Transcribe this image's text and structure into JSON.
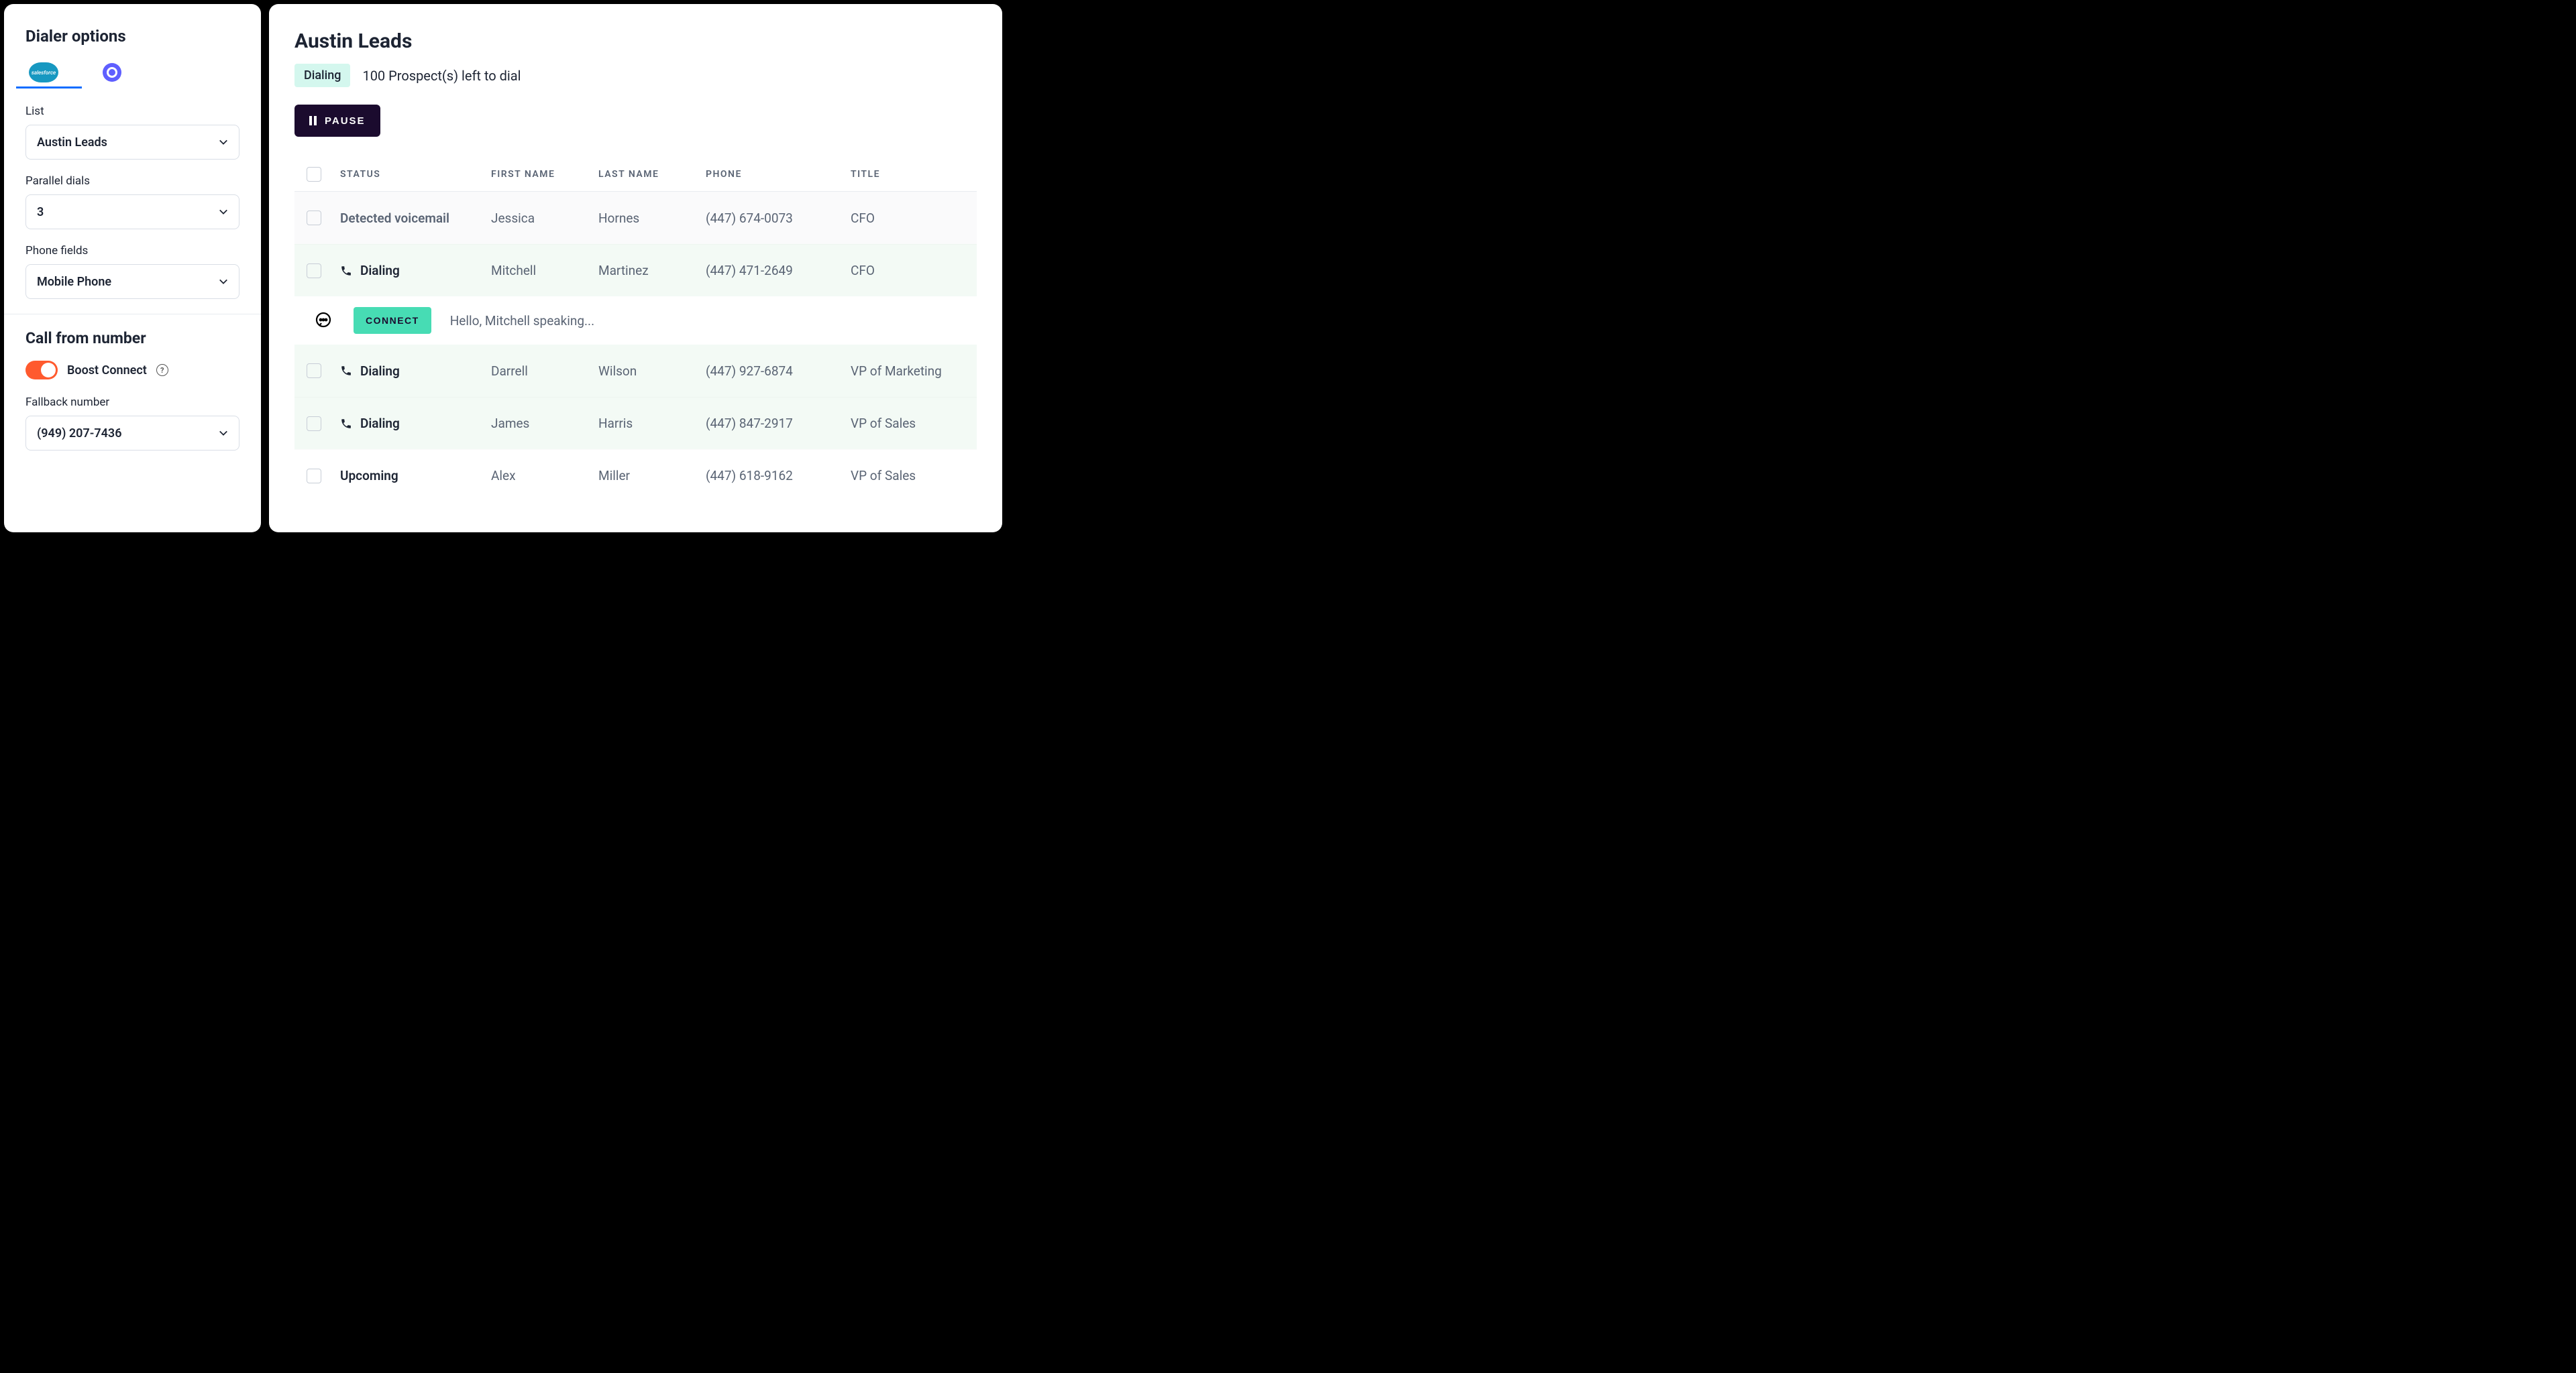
{
  "sidebar": {
    "title": "Dialer options",
    "list_label": "List",
    "list_value": "Austin Leads",
    "parallel_label": "Parallel dials",
    "parallel_value": "3",
    "phone_fields_label": "Phone fields",
    "phone_fields_value": "Mobile Phone",
    "call_from_title": "Call from number",
    "boost_label": "Boost Connect",
    "fallback_label": "Fallback number",
    "fallback_value": "(949) 207-7436"
  },
  "main": {
    "title": "Austin Leads",
    "status_badge": "Dialing",
    "status_text": "100 Prospect(s) left to dial",
    "pause_label": "PAUSE",
    "connect_label": "CONNECT",
    "connect_text": "Hello, Mitchell speaking...",
    "columns": {
      "status": "STATUS",
      "first": "FIRST NAME",
      "last": "LAST NAME",
      "phone": "PHONE",
      "title": "TITLE"
    },
    "rows": [
      {
        "status": "Detected voicemail",
        "first": "Jessica",
        "last": "Hornes",
        "phone": "(447) 674-0073",
        "title": "CFO",
        "variant": "voicemail"
      },
      {
        "status": "Dialing",
        "first": "Mitchell",
        "last": "Martinez",
        "phone": "(447) 471-2649",
        "title": "CFO",
        "variant": "dialing"
      },
      {
        "connect": true
      },
      {
        "status": "Dialing",
        "first": "Darrell",
        "last": "Wilson",
        "phone": "(447) 927-6874",
        "title": "VP of Marketing",
        "variant": "dialing"
      },
      {
        "status": "Dialing",
        "first": "James",
        "last": "Harris",
        "phone": "(447) 847-2917",
        "title": "VP of Sales",
        "variant": "dialing"
      },
      {
        "status": "Upcoming",
        "first": "Alex",
        "last": "Miller",
        "phone": "(447) 618-9162",
        "title": "VP of Sales",
        "variant": "upcoming"
      }
    ]
  }
}
